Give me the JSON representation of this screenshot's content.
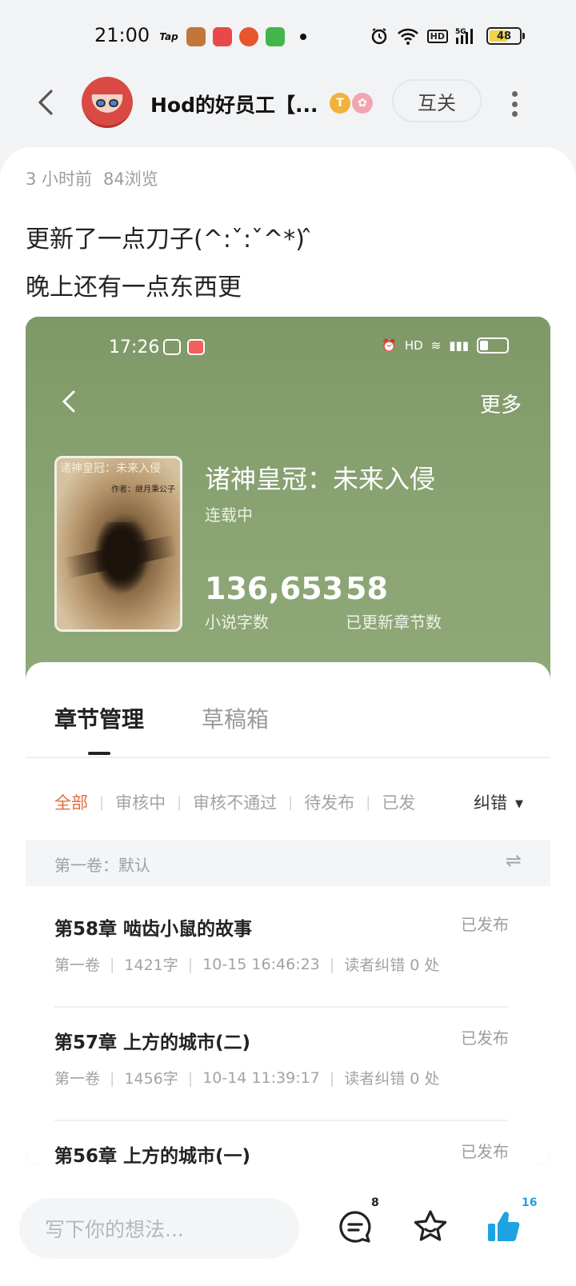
{
  "status_bar": {
    "time": "21:00",
    "tap_label": "Tap",
    "battery": "48",
    "hd_label": "HD",
    "network": "5G"
  },
  "header": {
    "username": "Hod的好员工【...",
    "badge_t": "T",
    "follow_label": "互关"
  },
  "post": {
    "time_ago": "3 小时前",
    "views": "84浏览",
    "line1": "更新了一点刀子(^:ˇ:ˇ^*) ̂",
    "line2": "晚上还有一点东西更"
  },
  "embedded": {
    "time": "17:26",
    "more_label": "更多",
    "cover_title": "诸神皇冠：未来入侵",
    "cover_author": "作者：继月秉公子",
    "book_title": "诸神皇冠：未来入侵",
    "book_status": "连载中",
    "word_count": "136,653",
    "word_count_label": "小说字数",
    "chapter_count": "58",
    "chapter_count_label": "已更新章节数",
    "tabs": [
      "章节管理",
      "草稿箱"
    ],
    "filters": [
      "全部",
      "审核中",
      "审核不通过",
      "待发布",
      "已发"
    ],
    "fix_label": "纠错",
    "volume_label": "第一卷：默认",
    "chapters": [
      {
        "title": "第58章 啮齿小鼠的故事",
        "status": "已发布",
        "volume": "第一卷",
        "words": "1421字",
        "time": "10-15 16:46:23",
        "errors": "读者纠错 0 处"
      },
      {
        "title": "第57章 上方的城市(二)",
        "status": "已发布",
        "volume": "第一卷",
        "words": "1456字",
        "time": "10-14 11:39:17",
        "errors": "读者纠错 0 处"
      },
      {
        "title": "第56章 上方的城市(一)",
        "status": "已发布"
      }
    ]
  },
  "bottom": {
    "placeholder": "写下你的想法...",
    "comment_count": "8",
    "like_count": "16"
  },
  "colors": {
    "accent_orange": "#e56a3c",
    "like_blue": "#1fa3e0",
    "green_header": "#8aa473"
  }
}
